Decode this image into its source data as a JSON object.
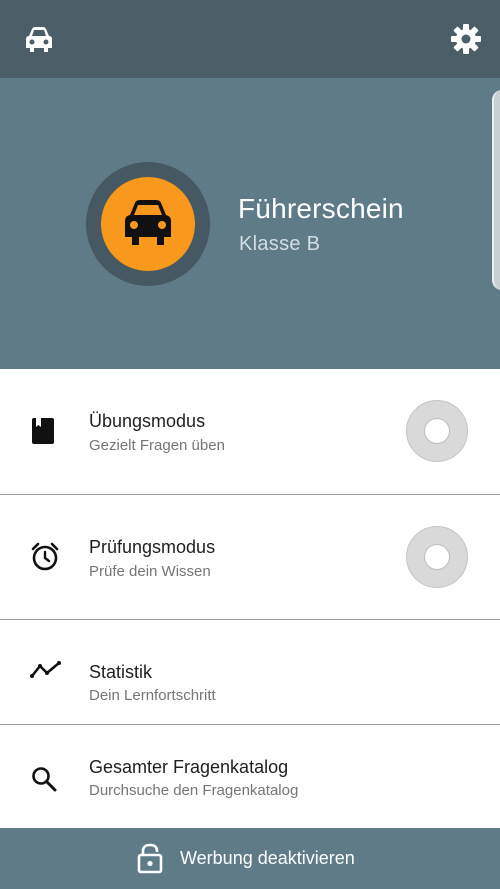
{
  "topbar": {
    "left_icon": "car-icon",
    "right_icon": "gear-icon"
  },
  "hero": {
    "title": "Führerschein",
    "subtitle": "Klasse B",
    "icon": "car-icon",
    "accent_color": "#f8991d"
  },
  "menu": {
    "items": [
      {
        "title": "Übungsmodus",
        "subtitle": "Gezielt Fragen üben",
        "icon": "book-icon",
        "has_toggle": true
      },
      {
        "title": "Prüfungsmodus",
        "subtitle": "Prüfe dein Wissen",
        "icon": "alarm-clock-icon",
        "has_toggle": true
      },
      {
        "title": "Statistik",
        "subtitle": "Dein Lernfortschritt",
        "icon": "trend-line-icon",
        "has_toggle": false
      },
      {
        "title": "Gesamter Fragenkatalog",
        "subtitle": "Durchsuche den Fragenkatalog",
        "icon": "search-icon",
        "has_toggle": false
      }
    ]
  },
  "bottombar": {
    "label": "Werbung deaktivieren",
    "icon": "lock-icon"
  },
  "colors": {
    "topbar": "#4b5d67",
    "hero": "#5f7b88",
    "bottombar": "#5f7b88"
  }
}
